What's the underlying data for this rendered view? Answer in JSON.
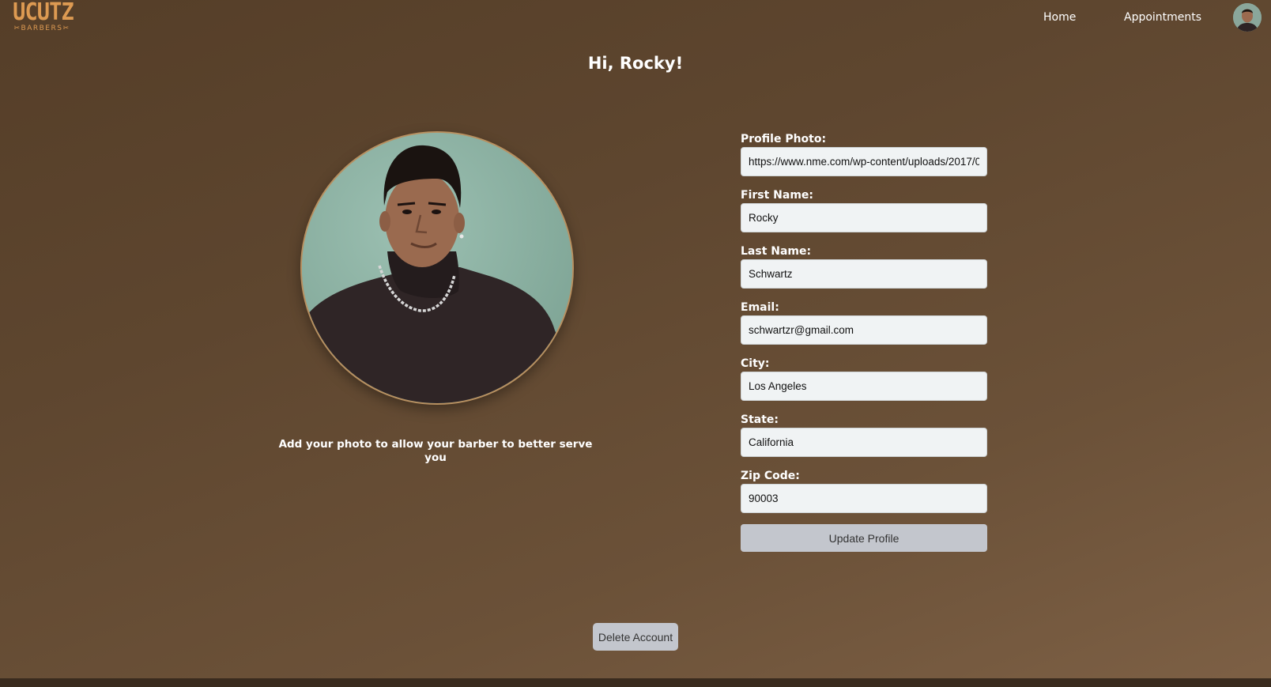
{
  "header": {
    "logo_main": "UCUTZ",
    "logo_sub": "BARBERS",
    "nav": {
      "home": "Home",
      "appointments": "Appointments"
    }
  },
  "main": {
    "greeting": "Hi, Rocky!",
    "photo_caption": "Add your photo to allow your barber to better serve you"
  },
  "form": {
    "fields": [
      {
        "label": "Profile Photo:",
        "value": "https://www.nme.com/wp-content/uploads/2017/0"
      },
      {
        "label": "First Name:",
        "value": "Rocky"
      },
      {
        "label": "Last Name:",
        "value": "Schwartz"
      },
      {
        "label": "Email:",
        "value": "schwartzr@gmail.com"
      },
      {
        "label": "City:",
        "value": "Los Angeles"
      },
      {
        "label": "State:",
        "value": "California"
      },
      {
        "label": "Zip Code:",
        "value": "90003"
      }
    ],
    "submit_label": "Update Profile"
  },
  "delete_label": "Delete Account",
  "icons": {
    "avatar": "user-avatar",
    "logo": "scissors-logo",
    "photo": "profile-photo"
  },
  "colors": {
    "brand_orange": "#dd9a52",
    "button_bg": "#c3c6cd",
    "input_bg": "#f0f3f4"
  }
}
